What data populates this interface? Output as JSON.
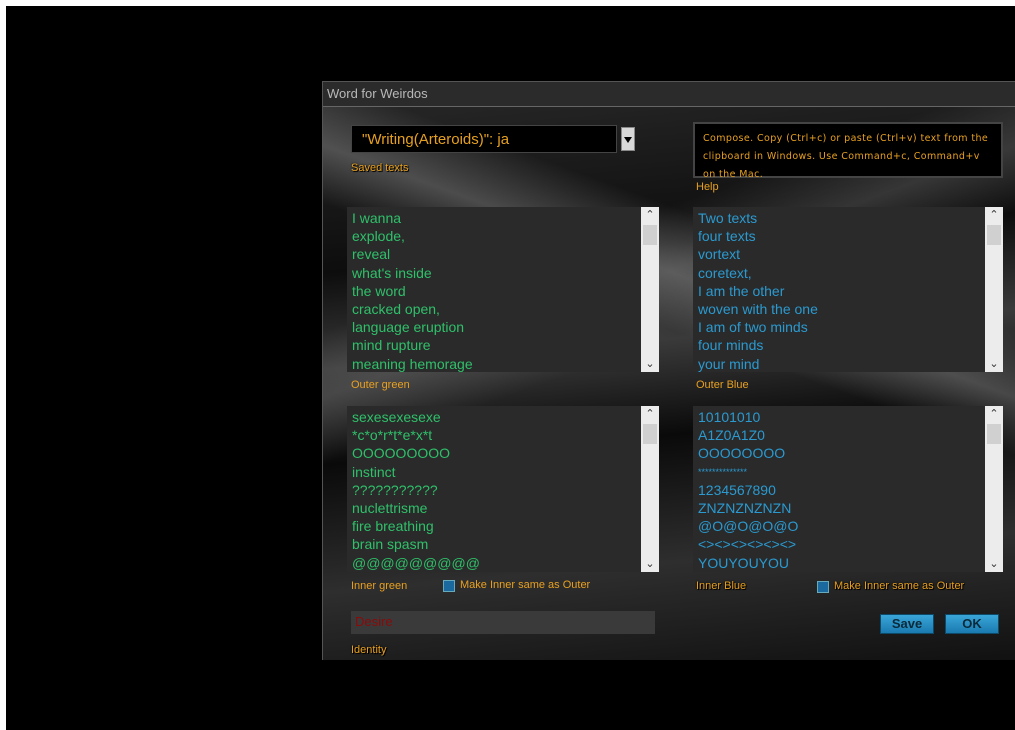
{
  "window": {
    "title": "Word for Weirdos"
  },
  "saved_texts": {
    "selected": "\"Writing(Arteroids)\": ja",
    "label": "Saved texts"
  },
  "help": {
    "text": "Compose. Copy (Ctrl+c) or paste (Ctrl+v) text from the clipboard in Windows. Use Command+c, Command+v on the Mac.",
    "label": "Help"
  },
  "outer_green": {
    "label": "Outer green",
    "lines": [
      "I wanna",
      "explode,",
      "reveal",
      "what's inside",
      "the word",
      "cracked open,",
      "language eruption",
      "mind rupture",
      "meaning hemorage"
    ]
  },
  "outer_blue": {
    "label": "Outer Blue",
    "lines": [
      "Two texts",
      "four texts",
      "vortext",
      "coretext,",
      "I am the other",
      "woven with the one",
      "I am of two minds",
      "four minds",
      "your mind"
    ]
  },
  "inner_green": {
    "label": "Inner green",
    "same_as_outer_label": "Make Inner same as Outer",
    "lines": [
      "sexesexesexe",
      "*c*o*r*t*e*x*t",
      "OOOOOOOOO",
      "instinct",
      "???????????",
      "nuclettrisme",
      "fire breathing",
      "brain spasm",
      "@@@@@@@@@"
    ]
  },
  "inner_blue": {
    "label": "Inner Blue",
    "same_as_outer_label": "Make Inner same as Outer",
    "lines": [
      "10101010",
      "A1Z0A1Z0",
      "OOOOOOOO",
      "**************",
      "1234567890",
      "ZNZNZNZNZN",
      "@O@O@O@O",
      "<><><><><><>",
      "YOUYOUYOU"
    ]
  },
  "identity": {
    "value": "Desire",
    "label": "Identity"
  },
  "buttons": {
    "save": "Save",
    "ok": "OK"
  },
  "colors": {
    "accent_orange": "#e8a020",
    "green_text": "#2fc06a",
    "blue_text": "#2a9ad0",
    "button_blue": "#2a90c8"
  }
}
